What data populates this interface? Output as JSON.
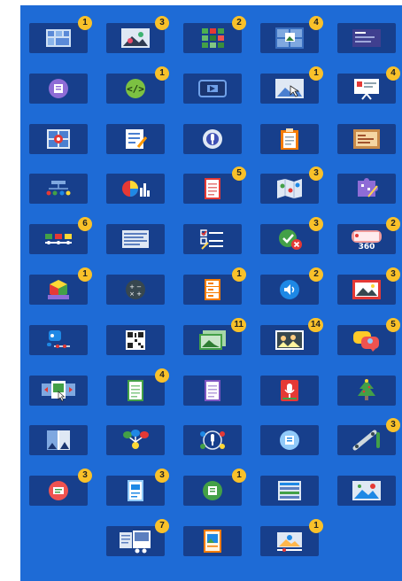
{
  "colors": {
    "panel": "#1e6bd6",
    "tile": "#173f8c",
    "badge": "#f9c12a"
  },
  "tiles": [
    {
      "icon": "photo-collage-icon",
      "badge": "1"
    },
    {
      "icon": "image-icon",
      "badge": "3"
    },
    {
      "icon": "color-grid-icon",
      "badge": "2"
    },
    {
      "icon": "image-grid-icon",
      "badge": "4"
    },
    {
      "icon": "presentation-icon",
      "badge": ""
    },
    {
      "icon": "purple-card-icon",
      "badge": ""
    },
    {
      "icon": "code-icon",
      "badge": "1"
    },
    {
      "icon": "video-frame-icon",
      "badge": ""
    },
    {
      "icon": "image-pointer-icon",
      "badge": "1"
    },
    {
      "icon": "slideshow-easel-icon",
      "badge": "4"
    },
    {
      "icon": "hotspot-image-icon",
      "badge": ""
    },
    {
      "icon": "edit-document-icon",
      "badge": ""
    },
    {
      "icon": "audio-narration-icon",
      "badge": ""
    },
    {
      "icon": "clipboard-icon",
      "badge": ""
    },
    {
      "icon": "cork-board-icon",
      "badge": ""
    },
    {
      "icon": "timeline-dots-icon",
      "badge": ""
    },
    {
      "icon": "chart-icon",
      "badge": ""
    },
    {
      "icon": "document-icon",
      "badge": "5"
    },
    {
      "icon": "map-icon",
      "badge": "3"
    },
    {
      "icon": "puzzle-icon",
      "badge": ""
    },
    {
      "icon": "timeline-bar-icon",
      "badge": "6"
    },
    {
      "icon": "text-lines-icon",
      "badge": ""
    },
    {
      "icon": "checklist-icon",
      "badge": ""
    },
    {
      "icon": "true-false-icon",
      "badge": "3"
    },
    {
      "icon": "virtual-tour-360-icon",
      "badge": "2"
    },
    {
      "icon": "3d-cube-icon",
      "badge": "1"
    },
    {
      "icon": "calculator-icon",
      "badge": ""
    },
    {
      "icon": "sorting-icon",
      "badge": "1"
    },
    {
      "icon": "audio-icon",
      "badge": "2"
    },
    {
      "icon": "image-frame-icon",
      "badge": "3"
    },
    {
      "icon": "dialog-cards-icon",
      "badge": ""
    },
    {
      "icon": "qr-code-icon",
      "badge": ""
    },
    {
      "icon": "image-stack-icon",
      "badge": "11"
    },
    {
      "icon": "image-sequence-icon",
      "badge": "14"
    },
    {
      "icon": "speech-bubbles-icon",
      "badge": "5"
    },
    {
      "icon": "image-slider-icon",
      "badge": ""
    },
    {
      "icon": "green-document-icon",
      "badge": "4"
    },
    {
      "icon": "purple-document-icon",
      "badge": ""
    },
    {
      "icon": "audio-recorder-icon",
      "badge": ""
    },
    {
      "icon": "christmas-tree-icon",
      "badge": ""
    },
    {
      "icon": "image-juxtaposition-icon",
      "badge": ""
    },
    {
      "icon": "mind-map-icon",
      "badge": ""
    },
    {
      "icon": "interactive-audio-icon",
      "badge": ""
    },
    {
      "icon": "blue-card-icon",
      "badge": ""
    },
    {
      "icon": "drag-line-icon",
      "badge": "3"
    },
    {
      "icon": "red-card-icon",
      "badge": "3"
    },
    {
      "icon": "flashcard-icon",
      "badge": "3"
    },
    {
      "icon": "green-card-icon",
      "badge": "1"
    },
    {
      "icon": "columns-icon",
      "badge": ""
    },
    {
      "icon": "image-hotspot-icon",
      "badge": ""
    },
    {
      "icon": "",
      "badge": ""
    },
    {
      "icon": "book-icon",
      "badge": "7"
    },
    {
      "icon": "framed-portrait-icon",
      "badge": ""
    },
    {
      "icon": "interactive-video-icon",
      "badge": "1"
    },
    {
      "icon": "",
      "badge": ""
    }
  ]
}
